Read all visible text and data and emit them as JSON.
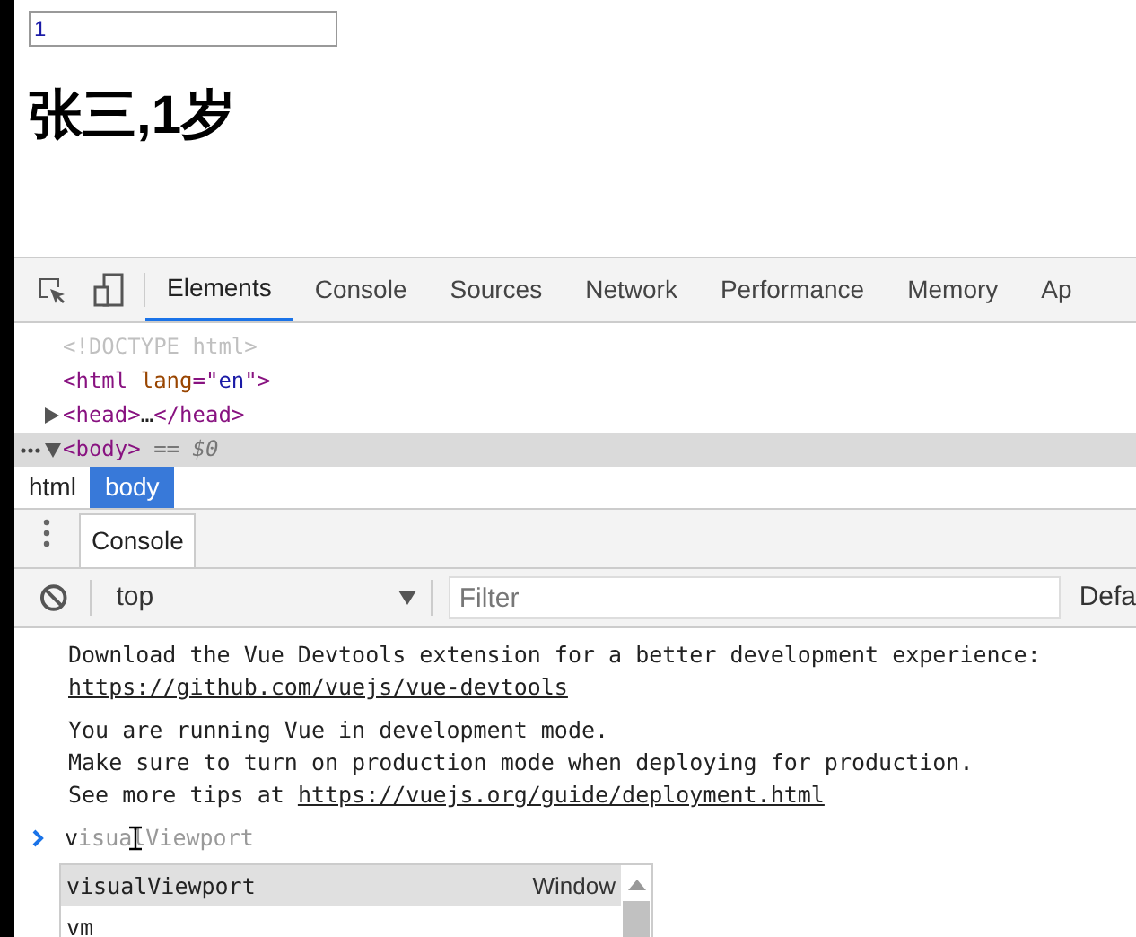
{
  "page": {
    "input_value": "1",
    "heading": "张三,1岁"
  },
  "devtools": {
    "tabs": [
      {
        "label": "Elements",
        "selected": true
      },
      {
        "label": "Console",
        "selected": false
      },
      {
        "label": "Sources",
        "selected": false
      },
      {
        "label": "Network",
        "selected": false
      },
      {
        "label": "Performance",
        "selected": false
      },
      {
        "label": "Memory",
        "selected": false
      },
      {
        "label": "Ap",
        "selected": false
      }
    ],
    "dom_tree": [
      {
        "selected": false,
        "parts": [
          {
            "kind": "doctype",
            "text": "<!DOCTYPE html>"
          }
        ]
      },
      {
        "selected": false,
        "parts": [
          {
            "kind": "tag",
            "text": "<html"
          },
          {
            "kind": "attr",
            "text": " lang"
          },
          {
            "kind": "tag",
            "text": "=\""
          },
          {
            "kind": "value",
            "text": "en"
          },
          {
            "kind": "tag",
            "text": "\">"
          }
        ]
      },
      {
        "expanded": false,
        "selected": false,
        "parts": [
          {
            "kind": "tag",
            "text": "<head>"
          },
          {
            "kind": "plain",
            "text": "…"
          },
          {
            "kind": "tag",
            "text": "</head>"
          }
        ]
      },
      {
        "expanded": true,
        "selected": true,
        "parts": [
          {
            "kind": "tag",
            "text": "<body>"
          },
          {
            "kind": "note",
            "text": " == $0"
          }
        ]
      }
    ],
    "breadcrumbs": [
      {
        "label": "html",
        "selected": false
      },
      {
        "label": "body",
        "selected": true
      }
    ],
    "drawer_tabs": [
      {
        "label": "Console",
        "selected": true
      }
    ],
    "console_toolbar": {
      "context": "top",
      "filter_placeholder": "Filter",
      "levels": "Defa"
    },
    "messages": [
      {
        "lines": [
          {
            "text": "Download the Vue Devtools extension for a better development experience:"
          },
          {
            "link": "https://github.com/vuejs/vue-devtools"
          }
        ]
      },
      {
        "lines": [
          {
            "text": "You are running Vue in development mode."
          },
          {
            "text": "Make sure to turn on production mode when deploying for production."
          },
          {
            "text": "See more tips at ",
            "link": "https://vuejs.org/guide/deployment.html"
          }
        ]
      }
    ],
    "prompt": {
      "typed": "v",
      "suggestion": "isualViewport"
    },
    "autocomplete": [
      {
        "label": "visualViewport",
        "type": "Window",
        "selected": true
      },
      {
        "label": "vm",
        "selected": false
      }
    ]
  }
}
